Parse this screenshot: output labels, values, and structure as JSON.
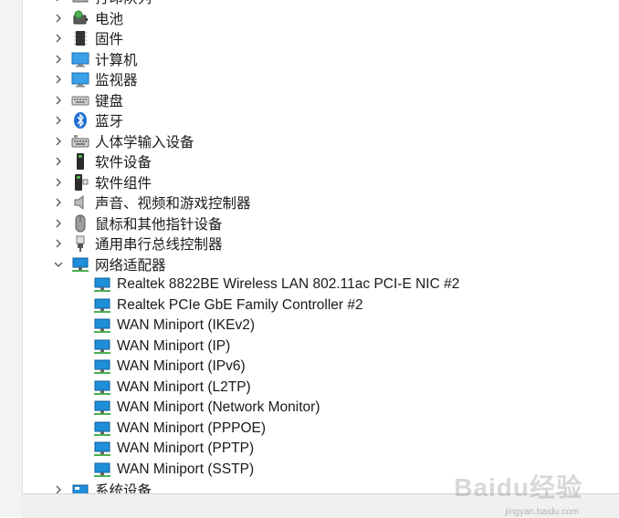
{
  "tree": {
    "categories_before": [
      {
        "label": "打印队列",
        "icon": "printer-icon"
      },
      {
        "label": "电池",
        "icon": "battery-icon"
      },
      {
        "label": "固件",
        "icon": "firmware-chip-icon"
      },
      {
        "label": "计算机",
        "icon": "computer-monitor-icon"
      },
      {
        "label": "监视器",
        "icon": "monitor-icon"
      },
      {
        "label": "键盘",
        "icon": "keyboard-icon"
      },
      {
        "label": "蓝牙",
        "icon": "bluetooth-icon"
      },
      {
        "label": "人体学输入设备",
        "icon": "hid-keyboard-icon"
      },
      {
        "label": "软件设备",
        "icon": "software-device-icon"
      },
      {
        "label": "软件组件",
        "icon": "software-component-icon"
      },
      {
        "label": "声音、视频和游戏控制器",
        "icon": "speaker-icon"
      },
      {
        "label": "鼠标和其他指针设备",
        "icon": "mouse-icon"
      },
      {
        "label": "通用串行总线控制器",
        "icon": "usb-icon"
      }
    ],
    "network": {
      "label": "网络适配器",
      "icon": "network-adapter-icon",
      "expanded": true,
      "children": [
        "Realtek 8822BE Wireless LAN 802.11ac PCI-E NIC #2",
        "Realtek PCIe GbE Family Controller #2",
        "WAN Miniport (IKEv2)",
        "WAN Miniport (IP)",
        "WAN Miniport (IPv6)",
        "WAN Miniport (L2TP)",
        "WAN Miniport (Network Monitor)",
        "WAN Miniport (PPPOE)",
        "WAN Miniport (PPTP)",
        "WAN Miniport (SSTP)"
      ]
    },
    "categories_after": [
      {
        "label": "系统设备",
        "icon": "system-device-icon"
      }
    ]
  },
  "watermark": {
    "logo": "Baidu经验",
    "url": "jingyan.baidu.com"
  },
  "colors": {
    "accent_network": "#1e8fd8",
    "text": "#1a1a1a",
    "chevron": "#555555"
  }
}
